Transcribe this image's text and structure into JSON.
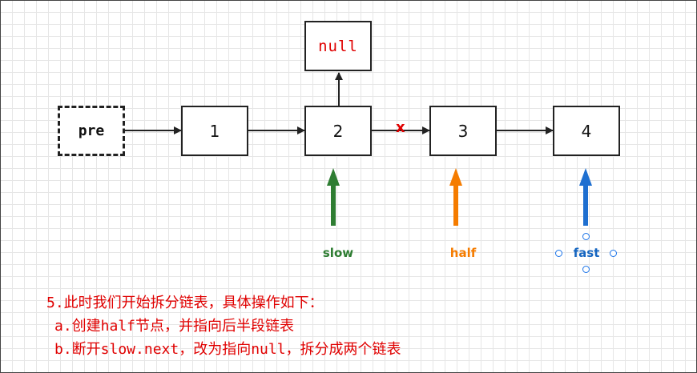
{
  "nodes": {
    "pre": "pre",
    "n1": "1",
    "n2": "2",
    "n3": "3",
    "n4": "4",
    "null": "null"
  },
  "cut_mark": "x",
  "pointers": {
    "slow": {
      "label": "slow",
      "color": "#2e7d32"
    },
    "half": {
      "label": "half",
      "color": "#f57c00"
    },
    "fast": {
      "label": "fast",
      "color": "#1565c0"
    }
  },
  "notes": {
    "line1": "5.此时我们开始拆分链表，具体操作如下：",
    "line2": "a.创建half节点，并指向后半段链表",
    "line3": "b.断开slow.next，改为指向null，拆分成两个链表"
  }
}
